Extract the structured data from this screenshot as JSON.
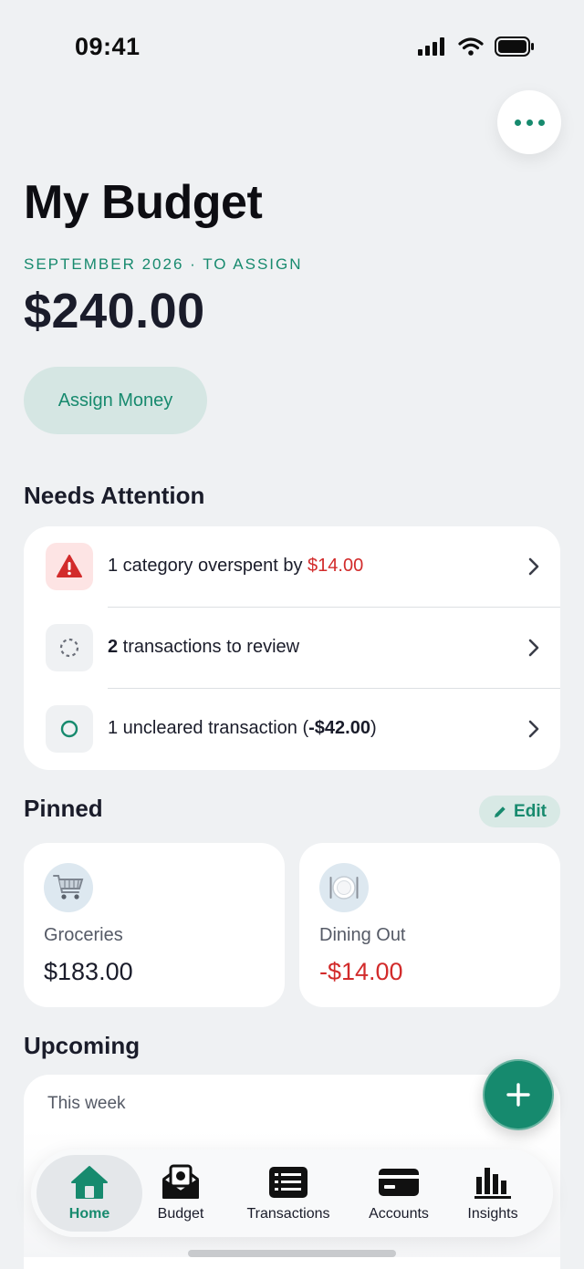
{
  "status_bar": {
    "time": "09:41"
  },
  "header": {
    "title": "My Budget",
    "month_label": "SEPTEMBER 2026 · TO ASSIGN",
    "to_assign": "$240.00",
    "assign_button": "Assign Money"
  },
  "attention": {
    "title": "Needs Attention",
    "items": [
      {
        "prefix": "1 category overspent by ",
        "highlight": "$14.00",
        "icon": "warning-icon"
      },
      {
        "count": "2",
        "text": " transactions to review",
        "icon": "pending-icon"
      },
      {
        "prefix": "1 uncleared transaction (",
        "amount": "-$42.00",
        "suffix": ")",
        "icon": "uncleared-icon"
      }
    ]
  },
  "pinned": {
    "title": "Pinned",
    "edit_label": "Edit",
    "cards": [
      {
        "name": "Groceries",
        "amount": "$183.00",
        "icon": "shopping-cart-icon"
      },
      {
        "name": "Dining Out",
        "amount": "-$14.00",
        "icon": "plate-icon"
      }
    ]
  },
  "upcoming": {
    "title": "Upcoming",
    "this_week": "This week"
  },
  "tabs": [
    {
      "label": "Home",
      "icon": "home-icon",
      "active": true
    },
    {
      "label": "Budget",
      "icon": "envelope-icon"
    },
    {
      "label": "Transactions",
      "icon": "list-icon"
    },
    {
      "label": "Accounts",
      "icon": "card-icon"
    },
    {
      "label": "Insights",
      "icon": "bar-chart-icon"
    }
  ],
  "colors": {
    "accent": "#178a6e",
    "negative": "#d22b2b",
    "background": "#eff1f3"
  }
}
